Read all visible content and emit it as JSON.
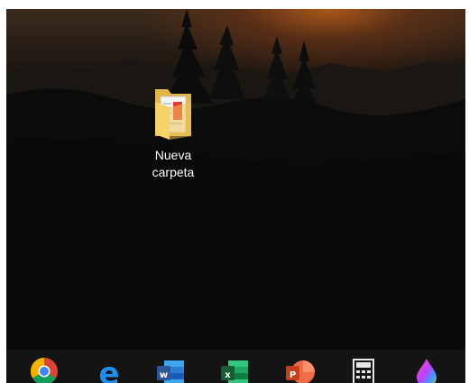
{
  "desktop": {
    "icons": [
      {
        "label_line1": "Nueva",
        "label_line2": "carpeta",
        "icon": "folder-icon"
      }
    ]
  },
  "taskbar": {
    "apps": [
      {
        "name": "chrome-icon",
        "color": "#DB4437"
      },
      {
        "name": "edge-icon",
        "color": "#1E8EF1"
      },
      {
        "name": "word-icon",
        "color": "#2B579A"
      },
      {
        "name": "excel-icon",
        "color": "#217346"
      },
      {
        "name": "powerpoint-icon",
        "color": "#D24726"
      },
      {
        "name": "calculator-icon",
        "color": "#E6E6E6"
      },
      {
        "name": "paint-icon",
        "color": "#8E44AD"
      }
    ]
  },
  "colors": {
    "sky_glow": "#C0601A",
    "taskbar": "#141414",
    "label_text": "#FFFFFF"
  }
}
